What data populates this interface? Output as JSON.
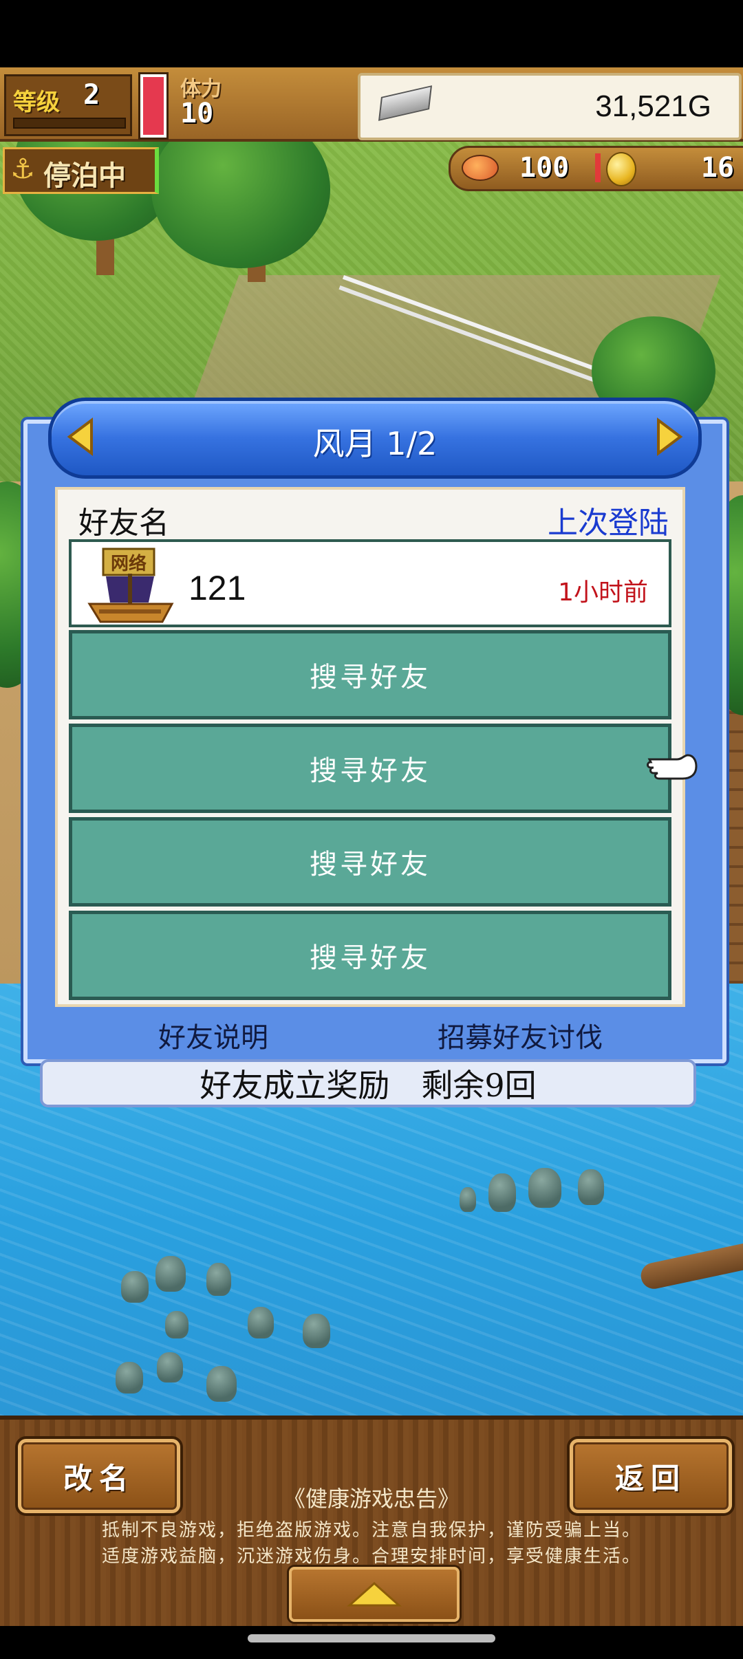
{
  "top_bar": {
    "level_label": "等级",
    "level_value": "2",
    "stamina_label": "体力",
    "stamina_value": "10",
    "money": "31,521G",
    "anchor_status": "停泊中",
    "food": "100",
    "coins": "16"
  },
  "dialog": {
    "title": "风月 1/2",
    "header_name": "好友名",
    "header_login": "上次登陆",
    "friend": {
      "badge": "网络",
      "name": "121",
      "last_login": "1小时前"
    },
    "search_rows": [
      "搜寻好友",
      "搜寻好友",
      "搜寻好友",
      "搜寻好友"
    ],
    "link_explain": "好友说明",
    "link_recruit": "招募好友讨伐",
    "reward": "好友成立奖励　剩余9回"
  },
  "bottom": {
    "rename_label": "改名",
    "back_label": "返回",
    "advice_title": "《健康游戏忠告》",
    "advice_line1": "抵制不良游戏，拒绝盗版游戏。注意自我保护，谨防受骗上当。",
    "advice_line2": "适度游戏益脑，沉迷游戏伤身。合理安排时间，享受健康生活。"
  },
  "colors": {
    "dialog_blue": "#5b8ee6",
    "search_row": "#5aa897",
    "last_login_red": "#c2131b",
    "login_header_blue": "#1a3bd0"
  },
  "icons": [
    "ingot-icon",
    "anchor-icon",
    "food-icon",
    "coin-icon",
    "prev-arrow-icon",
    "next-arrow-icon",
    "ship-icon",
    "pointer-hand-icon",
    "up-triangle-icon"
  ]
}
